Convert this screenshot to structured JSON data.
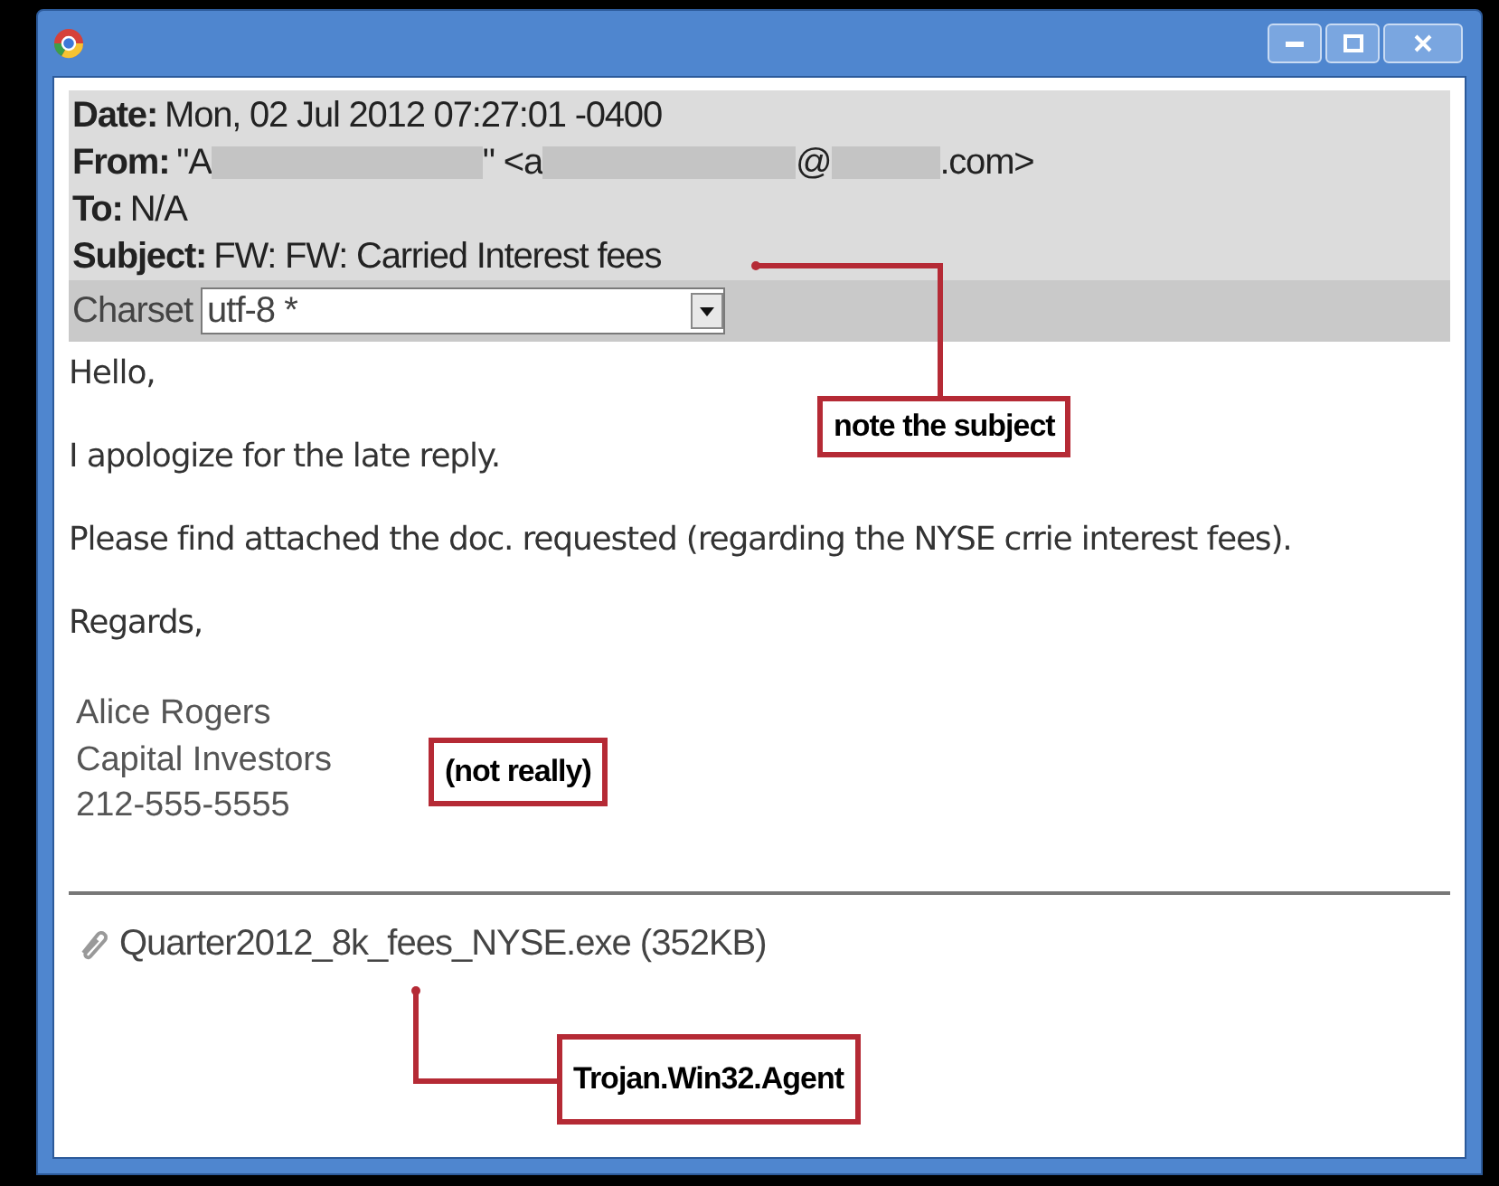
{
  "header": {
    "fields": [
      {
        "label": "Date:",
        "parts": [
          {
            "kind": "text",
            "text": "Mon, 02 Jul 2012 07:27:01 -0400"
          }
        ]
      },
      {
        "label": "From:",
        "parts": [
          {
            "kind": "text",
            "text": "\"A"
          },
          {
            "kind": "redaction"
          },
          {
            "kind": "text",
            "text": "\" <a"
          },
          {
            "kind": "redaction"
          },
          {
            "kind": "text",
            "text": "@"
          },
          {
            "kind": "redaction"
          },
          {
            "kind": "text",
            "text": ".com>"
          }
        ]
      },
      {
        "label": "To:",
        "parts": [
          {
            "kind": "text",
            "text": "N/A"
          }
        ]
      },
      {
        "label": "Subject:",
        "parts": [
          {
            "kind": "text",
            "text": "FW: FW: Carried Interest fees"
          }
        ]
      }
    ],
    "charset": {
      "label": "Charset",
      "value": "utf-8 *"
    }
  },
  "body": {
    "paragraphs": [
      "Hello,",
      "I apologize for the late reply.",
      "Please find attached the doc. requested (regarding the NYSE crrie interest fees).",
      "Regards,"
    ],
    "signature": [
      "Alice Rogers",
      "Capital Investors",
      "212-555-5555"
    ]
  },
  "attachment": {
    "name": "Quarter2012_8k_fees_NYSE.exe (352KB)"
  },
  "annotations": [
    {
      "text": "note the subject"
    },
    {
      "text": "(not really)"
    },
    {
      "text": "Trojan.Win32.Agent"
    }
  ]
}
